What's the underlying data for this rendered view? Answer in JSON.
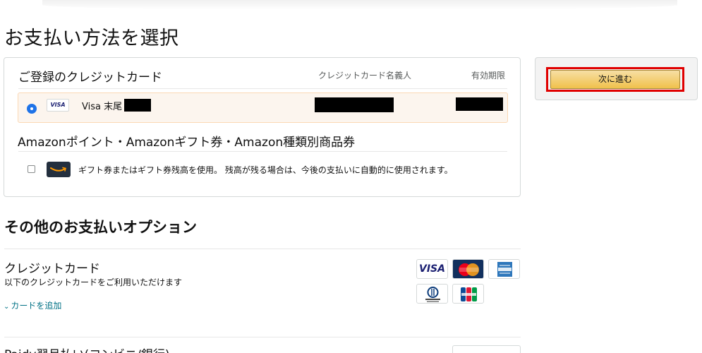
{
  "page_title": "お支払い方法を選択",
  "saved_cards": {
    "title": "ご登録のクレジットカード",
    "col_name": "クレジットカード名義人",
    "col_expiry": "有効期限",
    "card": {
      "brand_icon": "visa-icon",
      "brand_mini": "VISA",
      "label": "Visa 末尾",
      "selected": true
    }
  },
  "points": {
    "title": "Amazonポイント・Amazonギフト券・Amazon種類別商品券",
    "gift_text": "ギフト券またはギフト券残高を使用。 残高が残る場合は、今後の支払いに自動的に使用されます。",
    "checked": false
  },
  "other_options": {
    "title": "その他のお支払いオプション",
    "credit_card": {
      "title": "クレジットカード",
      "subtitle": "以下のクレジットカードをご利用いただけます",
      "add_link": "カードを追加",
      "logos": [
        "visa-logo",
        "mastercard-logo",
        "amex-logo",
        "diners-club-logo",
        "jcb-logo"
      ],
      "visa_text": "VISA"
    },
    "next_partial_title": "Paidy翌月払い(コンビニ/銀行)"
  },
  "sidebar": {
    "next_button": "次に進む"
  },
  "colors": {
    "accent_link": "#007185",
    "button_top": "#f7dfa5",
    "button_bottom": "#f0c14b",
    "highlight": "#e00000",
    "selected_row": "#fcf5ee",
    "radio": "#1e73e8"
  }
}
